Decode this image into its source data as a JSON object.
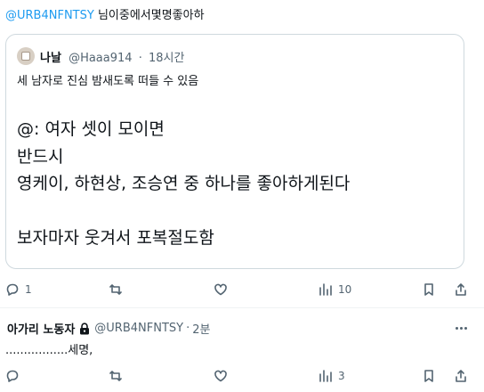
{
  "reply_context": {
    "mention": "@URB4NFNTSY",
    "text": "님이중에서몇명좋아하"
  },
  "quoted_tweet": {
    "name": "나날",
    "handle": "@Haaa914",
    "separator": "·",
    "time": "18시간",
    "text": "세 남자로 진심 밤새도록 떠들 수 있음",
    "body_lines": [
      "@: 여자 셋이 모이면",
      "반드시",
      "영케이, 하현상, 조승연 중 하나를 좋아하게된다",
      "",
      "보자마자 웃겨서 포복절도함"
    ]
  },
  "tweet_actions": {
    "replies": "1",
    "retweets": "",
    "likes": "",
    "views": "10"
  },
  "reply_tweet": {
    "name": "아가리 노동자",
    "handle": "@URB4NFNTSY",
    "separator": "·",
    "time": "2분",
    "text": ".................세명,"
  },
  "reply_actions": {
    "replies": "",
    "retweets": "",
    "likes": "",
    "views": "3"
  }
}
